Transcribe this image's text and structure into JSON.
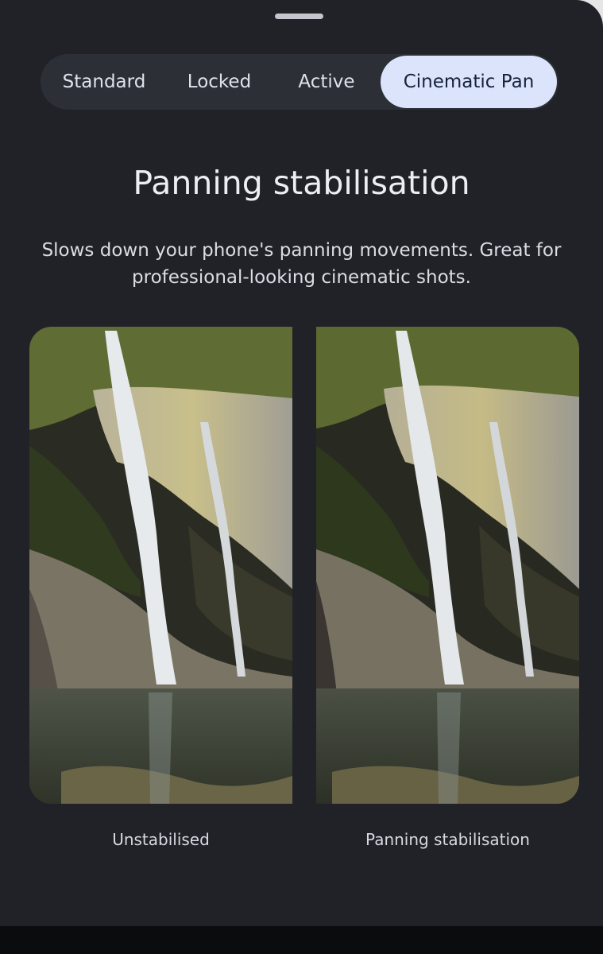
{
  "modes": {
    "standard": "Standard",
    "locked": "Locked",
    "active": "Active",
    "cinematic_pan": "Cinematic Pan",
    "selected": "Cinematic Pan"
  },
  "title": "Panning stabilisation",
  "description": "Slows down your phone's panning movements. Great for professional-looking cinematic shots.",
  "comparison": {
    "left_caption": "Unstabilised",
    "right_caption": "Panning stabilisation"
  },
  "colors": {
    "sheet_background": "#202228",
    "segmented_background": "#2c2f36",
    "selected_segment": "#dbe4fb",
    "selected_text": "#17233b"
  }
}
